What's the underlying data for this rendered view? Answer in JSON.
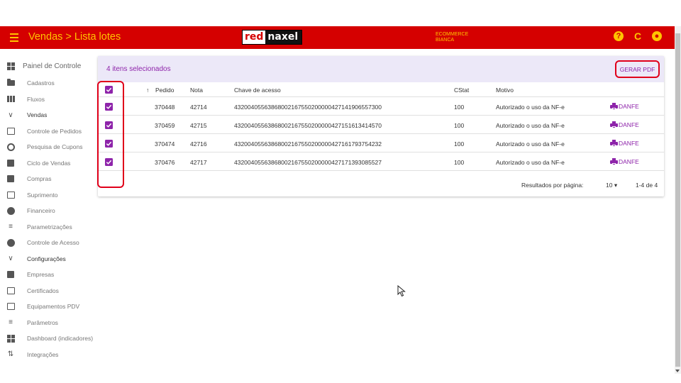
{
  "topbar": {
    "breadcrumb": "Vendas > Lista lotes",
    "logo_red": "red",
    "logo_naxel": "naxel",
    "store_line1": "ECOMMERCE",
    "store_line2": "BIANCA",
    "icons": [
      "help-icon",
      "refresh-icon",
      "account-icon"
    ],
    "accent": "#ffc400",
    "brand": "#d50000"
  },
  "sidebar": {
    "items": [
      {
        "label": "Painel de Controle",
        "icon": "dashboard-icon"
      },
      {
        "label": "Cadastros",
        "icon": "folder-icon"
      },
      {
        "label": "Fluxos",
        "icon": "columns-icon"
      },
      {
        "label": "Vendas",
        "icon": "chevron-down-icon"
      },
      {
        "label": "Controle de Pedidos",
        "icon": "inbox-icon"
      },
      {
        "label": "Pesquisa de Cupons",
        "icon": "search-icon"
      },
      {
        "label": "Ciclo de Vendas",
        "icon": "list-icon"
      },
      {
        "label": "Compras",
        "icon": "building-icon"
      },
      {
        "label": "Suprimento",
        "icon": "box-icon"
      },
      {
        "label": "Financeiro",
        "icon": "money-icon"
      },
      {
        "label": "Parametrizações",
        "icon": "tune-icon"
      },
      {
        "label": "Controle de Acesso",
        "icon": "shield-icon"
      },
      {
        "label": "Configurações",
        "icon": "chevron-down-icon"
      },
      {
        "label": "Empresas",
        "icon": "building-icon"
      },
      {
        "label": "Certificados",
        "icon": "certificate-icon"
      },
      {
        "label": "Equipamentos PDV",
        "icon": "monitor-icon"
      },
      {
        "label": "Parâmetros",
        "icon": "tune-icon"
      },
      {
        "label": "Dashboard (indicadores)",
        "icon": "dashboard-icon"
      },
      {
        "label": "Integrações",
        "icon": "swap-icon"
      }
    ]
  },
  "card": {
    "selected_text": "4 itens selecionados",
    "gerar_pdf": "GERAR PDF",
    "columns": [
      "Pedido",
      "Nota",
      "Chave de acesso",
      "CStat",
      "Motivo"
    ],
    "rows": [
      {
        "pedido": "370448",
        "nota": "42714",
        "chave": "43200405563868002167550200000427141906557300",
        "cstat": "100",
        "motivo": "Autorizado o uso da NF-e",
        "action": "DANFE",
        "checked": true
      },
      {
        "pedido": "370459",
        "nota": "42715",
        "chave": "43200405563868002167550200000427151613414570",
        "cstat": "100",
        "motivo": "Autorizado o uso da NF-e",
        "action": "DANFE",
        "checked": true
      },
      {
        "pedido": "370474",
        "nota": "42716",
        "chave": "43200405563868002167550200000427161793754232",
        "cstat": "100",
        "motivo": "Autorizado o uso da NF-e",
        "action": "DANFE",
        "checked": true
      },
      {
        "pedido": "370476",
        "nota": "42717",
        "chave": "43200405563868002167550200000427171393085527",
        "cstat": "100",
        "motivo": "Autorizado o uso da NF-e",
        "action": "DANFE",
        "checked": true
      }
    ],
    "footer": {
      "rows_per_page_label": "Resultados por página:",
      "rows_per_page_value": "10",
      "range": "1-4 de 4"
    }
  }
}
